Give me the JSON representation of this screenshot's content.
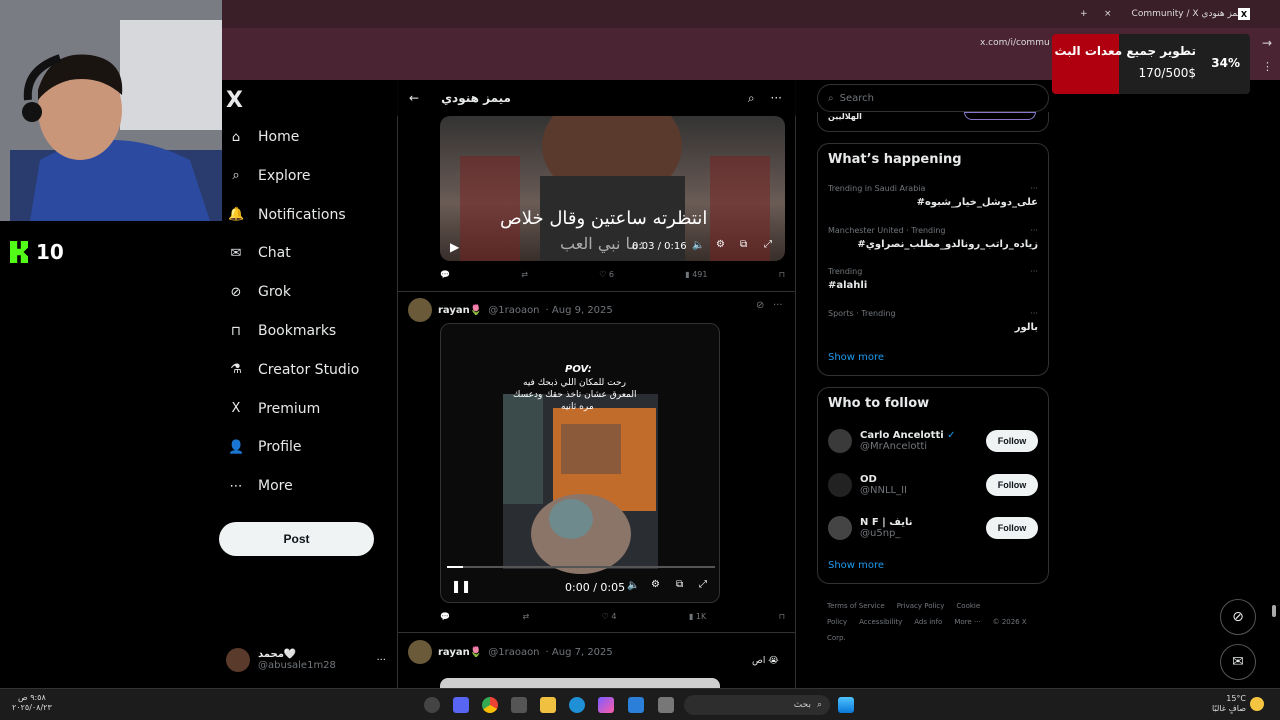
{
  "browser": {
    "tab_title": "Community / X ميمز هنودي",
    "url": "x.com/i/commu",
    "close_glyph": "×",
    "new_tab_glyph": "+"
  },
  "stream": {
    "kick_count": "10",
    "goal_title": "تطوير جميع معدات البث",
    "goal_amount": "170/500$",
    "goal_percent": "34%",
    "goal_fraction": 0.34
  },
  "sidebar": {
    "logo": "X",
    "items": [
      {
        "label": "Home",
        "icon": "home-icon"
      },
      {
        "label": "Explore",
        "icon": "search-icon"
      },
      {
        "label": "Notifications",
        "icon": "bell-icon"
      },
      {
        "label": "Chat",
        "icon": "mail-icon"
      },
      {
        "label": "Grok",
        "icon": "grok-icon"
      },
      {
        "label": "Bookmarks",
        "icon": "bookmark-icon"
      },
      {
        "label": "Creator Studio",
        "icon": "flask-icon"
      },
      {
        "label": "Premium",
        "icon": "x-icon"
      },
      {
        "label": "Profile",
        "icon": "person-icon"
      },
      {
        "label": "More",
        "icon": "more-circle-icon"
      }
    ],
    "post_label": "Post",
    "account": {
      "name": "محمد🤍",
      "handle": "@abusale1m28",
      "more": "···"
    }
  },
  "center": {
    "header_title": "ميمز هنودي",
    "tweet1": {
      "caption_line1": "انتظرته ساعتين وقال خلاص",
      "caption_line2": "ما نبي العب:",
      "time": "0:03 / 0:16",
      "replies": "",
      "retweets": "",
      "likes": "6",
      "views": "491"
    },
    "tweet2": {
      "name": "rayan🌷",
      "handle": "@1raoaon",
      "date": "· Aug 9, 2025",
      "pov": "POV:",
      "line1": "رحت للمكان اللي ذبحك فيه",
      "line2": "المعرق عشان تاخذ حقك ودعسك",
      "line3": "مره ثانيه",
      "time": "0:00 / 0:05",
      "likes": "4",
      "views": "1K",
      "progress": 0.0
    },
    "tweet3": {
      "name": "rayan🌷",
      "handle": "@1raoaon",
      "date": "· Aug 7, 2025",
      "text": "اص 😭"
    }
  },
  "right": {
    "search_placeholder": "Search",
    "top_fragment": "الهلاليين",
    "happening_title": "What’s happening",
    "trends": [
      {
        "meta": "Trending in Saudi Arabia",
        "tag": "#علی_دوشل_خیار_شبوه"
      },
      {
        "meta": "Manchester United · Trending",
        "tag": "#زیاده_راتب_رونالدو_مطلب_نصراوي"
      },
      {
        "meta": "Trending",
        "tag": "#alahli"
      },
      {
        "meta": "Sports · Trending",
        "tag": "بالور"
      }
    ],
    "show_more": "Show more",
    "who_title": "Who to follow",
    "follow_label": "Follow",
    "people": [
      {
        "name": "Carlo Ancelotti",
        "handle": "@MrAncelotti",
        "verified": true
      },
      {
        "name": "OD",
        "handle": "@NNLL_II",
        "verified": false
      },
      {
        "name": "N F | نايف",
        "handle": "@u5np_",
        "verified": false
      }
    ],
    "show_more2": "Show more",
    "footer": [
      "Terms of Service",
      "Privacy Policy",
      "Cookie Policy",
      "Accessibility",
      "Ads info",
      "More ···",
      "© 2026 X Corp."
    ]
  },
  "taskbar": {
    "time": "٩:٥٨ ص",
    "date": "٢٠٢٥/٠٨/٢٣",
    "search_placeholder": "بحث",
    "weather_temp": "15°C",
    "weather_desc": "صافٍ غالبًا"
  },
  "colors": {
    "accent": "#1d9bf0",
    "chrome": "#4a2433",
    "goal_red": "#b0000f",
    "kick_green": "#53fc18"
  }
}
